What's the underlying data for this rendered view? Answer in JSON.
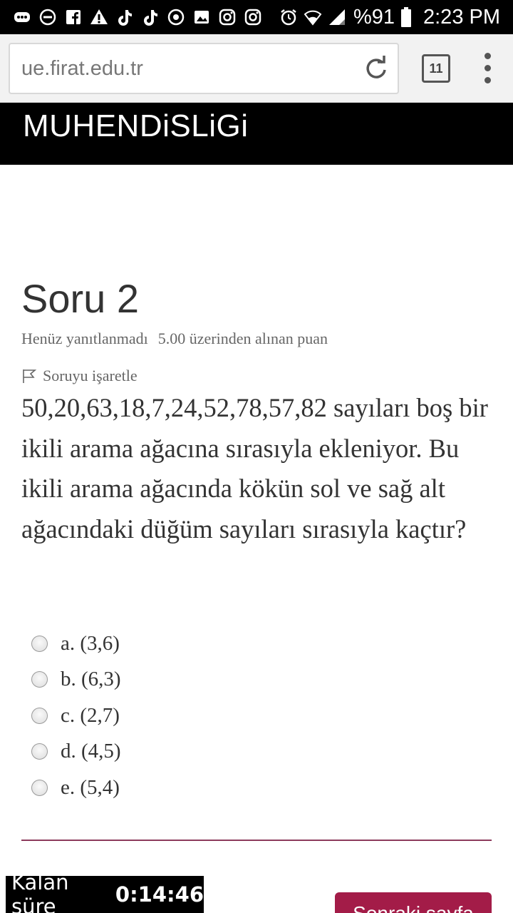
{
  "status_bar": {
    "notification_icons": [
      "message-icon",
      "do-not-disturb-icon",
      "facebook-icon",
      "warning-icon",
      "tiktok-icon",
      "tiktok-icon",
      "whatsapp-icon",
      "image-icon",
      "instagram-icon",
      "instagram-icon"
    ],
    "battery_percent": "%91",
    "time": "2:23 PM"
  },
  "browser": {
    "url": "ue.firat.edu.tr",
    "tab_count": "11"
  },
  "site_header": {
    "title": "MUHENDiSLiGi"
  },
  "question": {
    "title": "Soru 2",
    "status": "Henüz yanıtlanmadı",
    "grade": "5.00 üzerinden alınan puan",
    "flag_label": "Soruyu işaretle",
    "text": "50,20,63,18,7,24,52,78,57,82 sayıları boş bir ikili arama ağacına sırasıyla ekleniyor. Bu ikili arama ağacında kökün sol ve sağ alt ağacındaki düğüm sayıları sırasıyla kaçtır?",
    "answers": [
      {
        "label": "a. (3,6)"
      },
      {
        "label": "b. (6,3)"
      },
      {
        "label": "c. (2,7)"
      },
      {
        "label": "d. (4,5)"
      },
      {
        "label": "e. (5,4)"
      }
    ]
  },
  "timer": {
    "label": "Kalan süre",
    "value": "0:14:46"
  },
  "next_button": {
    "label": "Sonraki sayfa"
  },
  "colors": {
    "accent": "#a31c48",
    "divider": "#8c3a5c"
  }
}
